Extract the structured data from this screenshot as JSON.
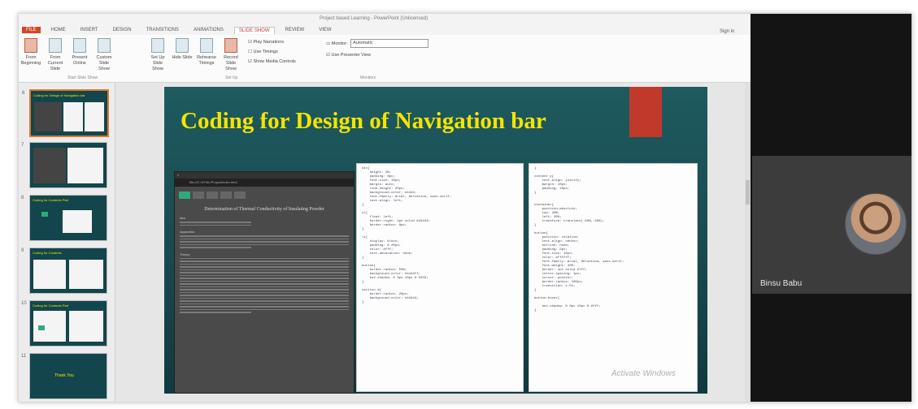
{
  "window": {
    "title": "Project based Learning - PowerPoint (Unlicensed)",
    "sign_in": "Sign in"
  },
  "tabs": [
    "FILE",
    "HOME",
    "INSERT",
    "DESIGN",
    "TRANSITIONS",
    "ANIMATIONS",
    "SLIDE SHOW",
    "REVIEW",
    "VIEW"
  ],
  "active_tab": "SLIDE SHOW",
  "ribbon": {
    "buttons": [
      "From Beginning",
      "From Current Slide",
      "Present Online",
      "Custom Slide Show",
      "Set Up Slide Show",
      "Hide Slide",
      "Rehearse Timings",
      "Record Slide Show"
    ],
    "checkboxes": [
      "Play Narrations",
      "Use Timings",
      "Show Media Controls"
    ],
    "monitor_label": "Monitor:",
    "monitor_value": "Automatic",
    "presenter_view": "Use Presenter View",
    "groups": [
      "Start Slide Show",
      "Set Up",
      "Monitors"
    ]
  },
  "thumbnails": [
    {
      "num": "6",
      "title": "Coding for Design of Navigation bar"
    },
    {
      "num": "7",
      "title": ""
    },
    {
      "num": "8",
      "title": "Coding for Contents Part"
    },
    {
      "num": "9",
      "title": "Coding for Contents"
    },
    {
      "num": "10",
      "title": "Coding for Contents Part"
    },
    {
      "num": "11",
      "title": "Thank You"
    }
  ],
  "slide": {
    "title": "Coding for Design of Navigation bar",
    "browser": {
      "url": "file:///C:/HTML/Project/index.html",
      "heading": "Determination of Thermal Conductivity of Insulating Powder",
      "sections": [
        "Aim",
        "Apparatus",
        "Theory"
      ]
    },
    "code1": "div{\n    height: 4%;\n    padding: 8px;\n    font-size: 16px;\n    margin: auto;\n    line-height: 20px;\n    background-color: #4444;\n    font-family: Arial, Helvetica, sans-serif;\n    text-align: left;\n}\n\nul{\n    float: left;\n    border-right: 1px solid #44444;\n    border-radius: 8px;\n}\n\nli{\n    display: block;\n    padding: 8 20px;\n    color: #fff;\n    text-decoration: none;\n}\n\nbutton{\n    border-radius: 50%;\n    background-color: #4444ff;\n    box-shadow: 0 3px 10px 0 #333;\n}\n\nsection a{\n    border-radius: 20px;\n    background-color: #44444;\n}",
    "code2": "}\n\ncontent p{\n    text-align: justify;\n    margin: 10px;\n    padding: 10px;\n}\n\n\ncontainer{\n    position:absolute;\n    top: 20%;\n    left: 30%;\n    transform: translate(-50%,-50%);\n}\n\nbutton{\n    position: relative;\n    text-align: center;\n    outline: none;\n    padding: 5px;\n    font-size: 18px;\n    color: #ffffff;\n    font-family: Arial, Helvetica, sans-serif;\n    font-weight: 400;\n    border: 1px solid #fff;\n    letter-spacing: 1px;\n    cursor: pointer;\n    border-radius: 100px;\n    transition: 1.5s;\n}\n\nbutton:hover{\n\n    box-shadow: 0 0px 10px 0 #fff;\n}",
    "watermark": "Activate Windows"
  },
  "participant": {
    "name": "Binsu Babu"
  }
}
